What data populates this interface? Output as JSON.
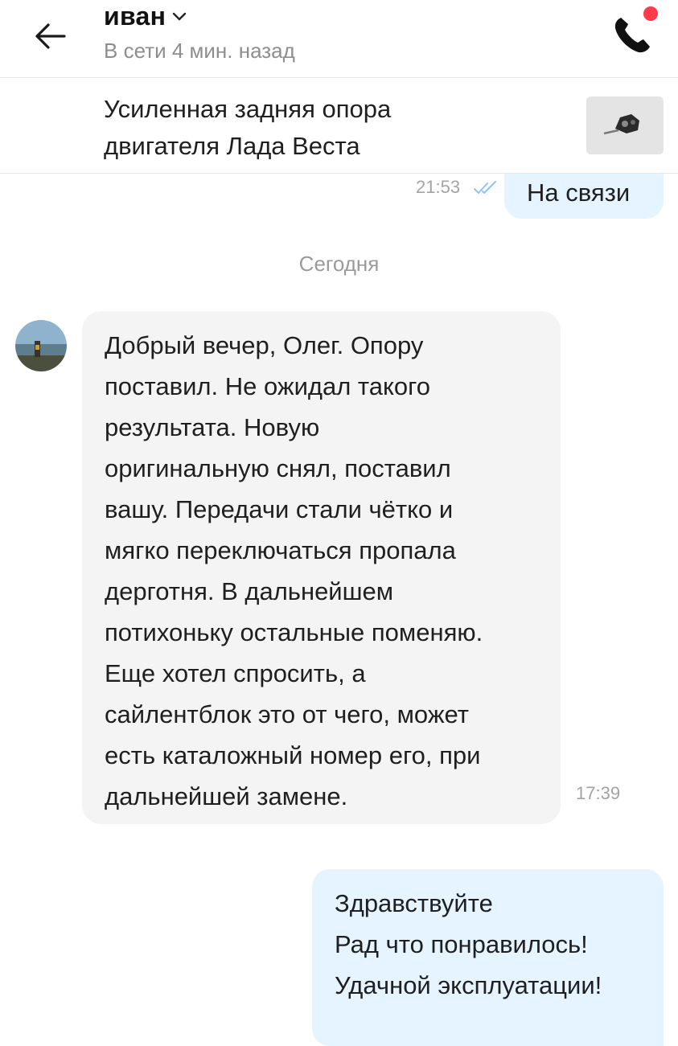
{
  "header": {
    "contact_name": "иван",
    "status": "В сети 4 мин. назад",
    "accent_color": "#ff3b4c"
  },
  "item": {
    "title_line1": "Усиленная задняя опора",
    "title_line2": "двигателя Лада Веста"
  },
  "messages": [
    {
      "direction": "outgoing",
      "text_lines": [
        "На связи"
      ],
      "time": "21:53",
      "read": true
    },
    {
      "direction": "incoming",
      "text_lines": [
        "Добрый вечер, Олег. Опору",
        "поставил. Не ожидал такого",
        "результата. Новую",
        "оригинальную снял, поставил",
        "вашу. Передачи стали чётко и",
        "мягко переключаться пропала",
        "дерготня. В дальнейшем",
        "потихоньку остальные поменяю.",
        "Еще хотел спросить, а",
        "сайлентблок это от чего, может",
        "есть каталожный номер его, при",
        "дальнейшей замене."
      ],
      "time": "17:39"
    },
    {
      "direction": "outgoing",
      "text_lines": [
        "Здравствуйте",
        "Рад что понравилось!",
        "Удачной эксплуатации!"
      ]
    }
  ],
  "date_separator": "Сегодня",
  "icons": {
    "back": "arrow-left-icon",
    "dropdown": "chevron-down-icon",
    "call": "phone-icon",
    "read": "double-check-icon"
  }
}
